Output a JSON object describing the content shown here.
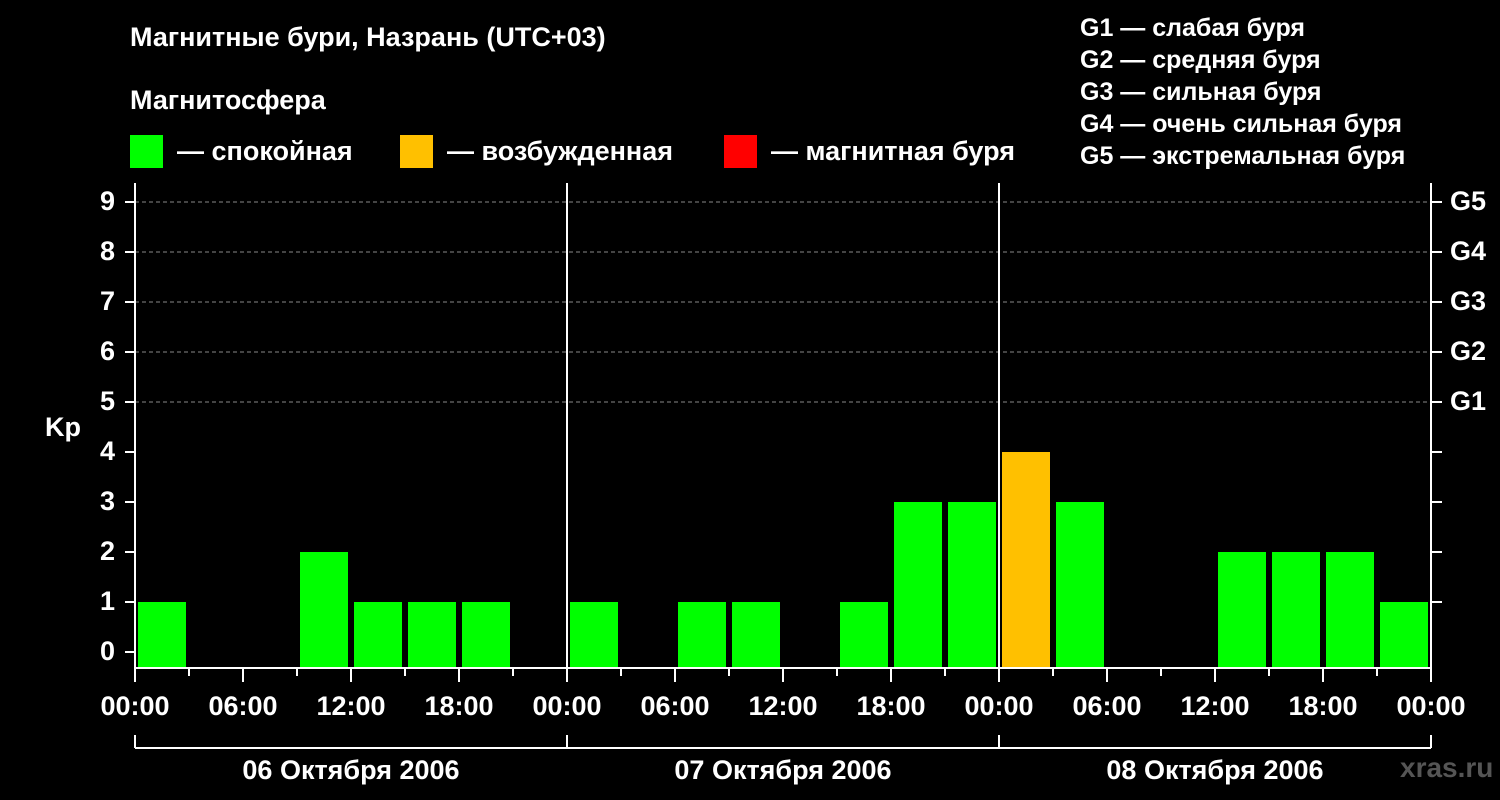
{
  "header": {
    "title": "Магнитные бури, Назрань (UTC+03)",
    "magnetosphere_label": "Магнитосфера"
  },
  "legend": [
    {
      "color": "#00ff00",
      "label": "— спокойная"
    },
    {
      "color": "#ffc000",
      "label": "— возбужденная"
    },
    {
      "color": "#ff0000",
      "label": "— магнитная буря"
    }
  ],
  "g_legend": [
    "G1 — слабая буря",
    "G2 — средняя буря",
    "G3 — сильная буря",
    "G4 — очень сильная буря",
    "G5 — экстремальная буря"
  ],
  "watermark": "xras.ru",
  "chart_data": {
    "type": "bar",
    "ylabel": "Kp",
    "ylim": [
      0,
      9
    ],
    "yticks": [
      "0",
      "1",
      "2",
      "3",
      "4",
      "5",
      "6",
      "7",
      "8",
      "9"
    ],
    "right_ticks": [
      {
        "kp": 5,
        "label": "G1"
      },
      {
        "kp": 6,
        "label": "G2"
      },
      {
        "kp": 7,
        "label": "G3"
      },
      {
        "kp": 8,
        "label": "G4"
      },
      {
        "kp": 9,
        "label": "G5"
      }
    ],
    "grid": "dashed horizontal at Kp 5-9",
    "xtick_labels": [
      "00:00",
      "06:00",
      "12:00",
      "18:00",
      "00:00",
      "06:00",
      "12:00",
      "18:00",
      "00:00",
      "06:00",
      "12:00",
      "18:00",
      "00:00"
    ],
    "days": [
      "06 Октября 2006",
      "07 Октября 2006",
      "08 Октября 2006"
    ],
    "interval_hours": 3,
    "values": [
      1,
      0,
      0,
      2,
      1,
      1,
      1,
      0,
      1,
      0,
      1,
      1,
      0,
      1,
      3,
      3,
      4,
      3,
      0,
      0,
      2,
      2,
      2,
      1
    ],
    "colors": {
      "quiet": "#00ff00",
      "active": "#ffc000",
      "storm": "#ff0000"
    }
  }
}
